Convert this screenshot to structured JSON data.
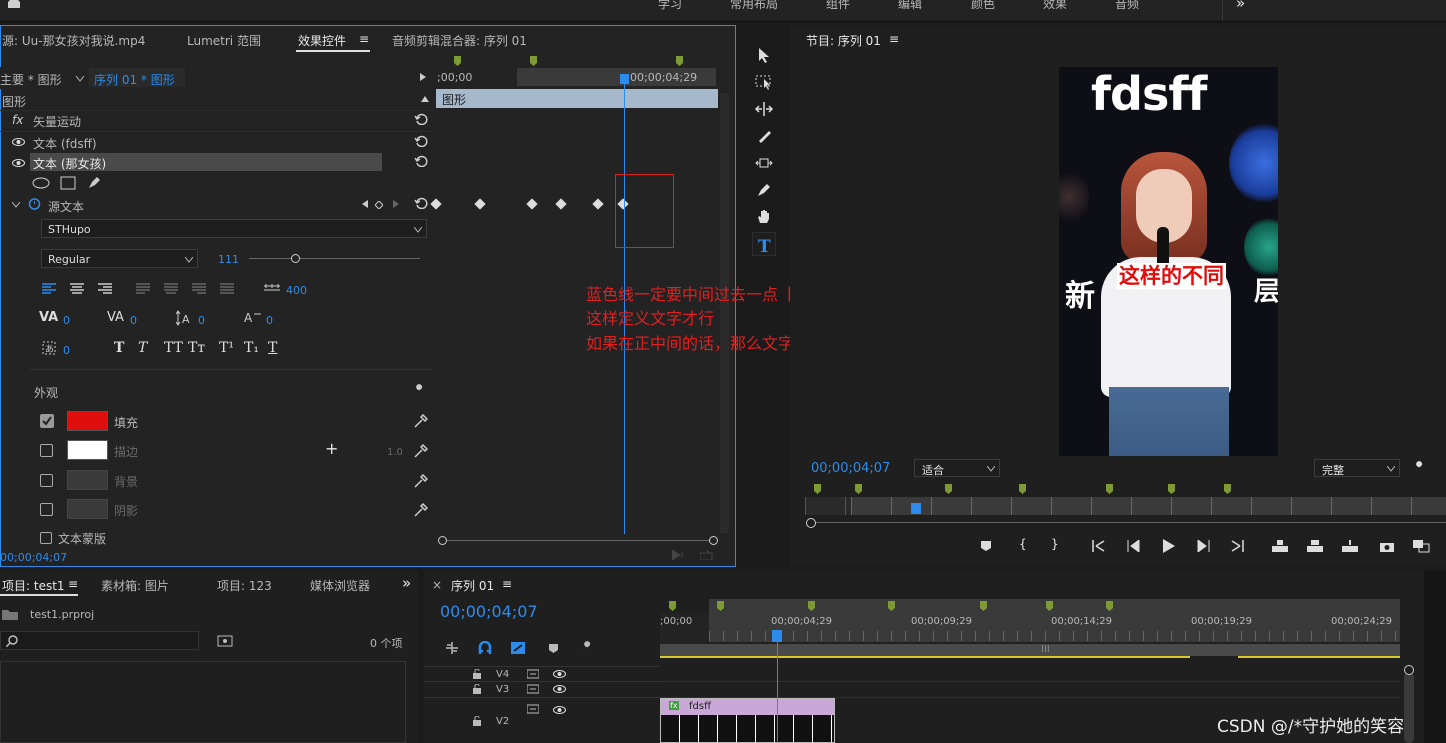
{
  "top_menu": [
    "学习",
    "常用布局",
    "组件",
    "编辑",
    "颜色",
    "效果",
    "音频"
  ],
  "top_more": "»",
  "ec": {
    "tabs": [
      "源: Uu-那女孩对我说.mp4",
      "Lumetri 范围",
      "效果控件",
      "音频剪辑混合器: 序列 01"
    ],
    "tab_menu": "≡",
    "master_left": "主要 * 图形",
    "master_right": "序列 01 * 图形",
    "section_label": "图形",
    "rows": {
      "vector": "矢量运动",
      "text1": "文本 (fdsff)",
      "text2": "文本 (那女孩)",
      "source": "源文本"
    },
    "fx": "fx",
    "timecodes": {
      "start": ";00;00",
      "end": "00;00;04;29",
      "current": "00;00;04;07"
    },
    "clip_label": "图形",
    "font_family": "STHupo",
    "font_style": "Regular",
    "font_size": "111",
    "tracking_value": "400",
    "zeros": "0",
    "style_buttons": [
      "T",
      "T",
      "TT",
      "Tт",
      "T¹",
      "T₁",
      "T"
    ],
    "appearance": "外观",
    "fill": {
      "label": "填充",
      "color": "#e00d0d",
      "checked": true
    },
    "stroke": {
      "label": "描边",
      "color": "#ffffff",
      "width": "1.0",
      "checked": false
    },
    "background": {
      "label": "背景",
      "checked": false
    },
    "shadow": {
      "label": "阴影",
      "checked": false
    },
    "mask": "文本蒙版",
    "plus": "+"
  },
  "annotation": {
    "line1": "蓝色线一定要中间过去一点【如这，过来一点左边是空白",
    "line2": "这样定义文字才行",
    "line3": "如果在正中间的话，那么文字只有一瞬间啊",
    "color": "#e02020"
  },
  "program": {
    "title": "节目: 序列 01",
    "menu": "≡",
    "video_title": "fdsff",
    "video_subtitle_left": "新",
    "video_subtitle": "这样的不同",
    "video_subtitle_right": "层",
    "timecode": "00;00;04;07",
    "fit": "适合",
    "quality": "完整"
  },
  "project": {
    "tabs": [
      "项目: test1",
      "素材箱: 图片",
      "项目: 123",
      "媒体浏览器"
    ],
    "menu": "≡",
    "more": "»",
    "file": "test1.prproj",
    "search_placeholder": "",
    "count": "0 个项"
  },
  "timeline": {
    "close": "×",
    "title": "序列 01",
    "menu": "≡",
    "timecode": "00;00;04;07",
    "ruler": [
      ";00;00",
      "00;00;04;29",
      "00;00;09;29",
      "00;00;14;29",
      "00;00;19;29",
      "00;00;24;29"
    ],
    "tracks": [
      "V4",
      "V3",
      "V2"
    ],
    "clip_label": "fdsff",
    "clip_fx": "fx",
    "scroll_mid": "III"
  },
  "watermark": "CSDN @/*守护她的笑容"
}
